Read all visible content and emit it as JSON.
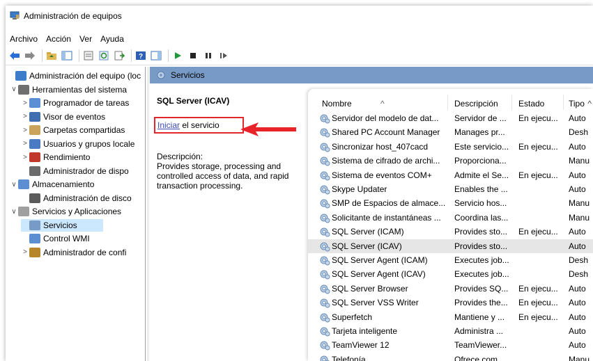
{
  "window": {
    "title": "Administración de equipos"
  },
  "menu": {
    "items": [
      "Archivo",
      "Acción",
      "Ver",
      "Ayuda"
    ]
  },
  "tree": {
    "items": [
      {
        "label": "Administración del equipo (loc",
        "expander": "",
        "indent": 0
      },
      {
        "label": "Herramientas del sistema",
        "expander": "∨",
        "indent": 1
      },
      {
        "label": "Programador de tareas",
        "expander": ">",
        "indent": 2
      },
      {
        "label": "Visor de eventos",
        "expander": ">",
        "indent": 2
      },
      {
        "label": "Carpetas compartidas",
        "expander": ">",
        "indent": 2
      },
      {
        "label": "Usuarios y grupos locale",
        "expander": ">",
        "indent": 2
      },
      {
        "label": "Rendimiento",
        "expander": ">",
        "indent": 2
      },
      {
        "label": "Administrador de dispo",
        "expander": "",
        "indent": 2
      },
      {
        "label": "Almacenamiento",
        "expander": "∨",
        "indent": 1
      },
      {
        "label": "Administración de disco",
        "expander": "",
        "indent": 2
      },
      {
        "label": "Servicios y Aplicaciones",
        "expander": "∨",
        "indent": 1
      },
      {
        "label": "Servicios",
        "expander": "",
        "indent": 2
      },
      {
        "label": "Control WMI",
        "expander": "",
        "indent": 2
      },
      {
        "label": "Administrador de confi",
        "expander": ">",
        "indent": 2
      }
    ]
  },
  "header": {
    "label": "Servicios"
  },
  "ext": {
    "service_name": "SQL Server (ICAV)",
    "start_link": "Iniciar",
    "start_rest": " el servicio",
    "desc_label": "Descripción:",
    "desc_text": "Provides storage, processing and controlled access of data, and rapid transaction processing."
  },
  "list": {
    "columns": [
      "Nombre",
      "Descripción",
      "Estado",
      "Tipo"
    ],
    "rows": [
      [
        "Servidor del modelo de dat...",
        "Servidor de ...",
        "En ejecu...",
        "Auto"
      ],
      [
        "Shared PC Account Manager",
        "Manages pr...",
        "",
        "Desh"
      ],
      [
        "Sincronizar host_407cacd",
        "Este servicio...",
        "En ejecu...",
        "Auto"
      ],
      [
        "Sistema de cifrado de archi...",
        "Proporciona...",
        "",
        "Manu"
      ],
      [
        "Sistema de eventos COM+",
        "Admite el Se...",
        "En ejecu...",
        "Auto"
      ],
      [
        "Skype Updater",
        "Enables the ...",
        "",
        "Auto"
      ],
      [
        "SMP de Espacios de almace...",
        "Servicio hos...",
        "",
        "Manu"
      ],
      [
        "Solicitante de instantáneas ...",
        "Coordina las...",
        "",
        "Manu"
      ],
      [
        "SQL Server (ICAM)",
        "Provides sto...",
        "En ejecu...",
        "Auto"
      ],
      [
        "SQL Server (ICAV)",
        "Provides sto...",
        "",
        "Auto"
      ],
      [
        "SQL Server Agent (ICAM)",
        "Executes job...",
        "",
        "Desh"
      ],
      [
        "SQL Server Agent (ICAV)",
        "Executes job...",
        "",
        "Desh"
      ],
      [
        "SQL Server Browser",
        "Provides SQ...",
        "En ejecu...",
        "Auto"
      ],
      [
        "SQL Server VSS Writer",
        "Provides the...",
        "En ejecu...",
        "Auto"
      ],
      [
        "Superfetch",
        "Mantiene y ...",
        "En ejecu...",
        "Auto"
      ],
      [
        "Tarjeta inteligente",
        "Administra ...",
        "",
        "Auto"
      ],
      [
        "TeamViewer 12",
        "TeamViewer...",
        "",
        "Auto"
      ],
      [
        "Telefonía",
        "Ofrece com...",
        "",
        "Manu"
      ]
    ],
    "selected_row": "SQL Server (ICAV)"
  },
  "colors": {
    "header_bar": "#789ac6",
    "highlight_box": "#e0282a",
    "link": "#3b4bb0",
    "tree_selected": "#cce8ff"
  }
}
